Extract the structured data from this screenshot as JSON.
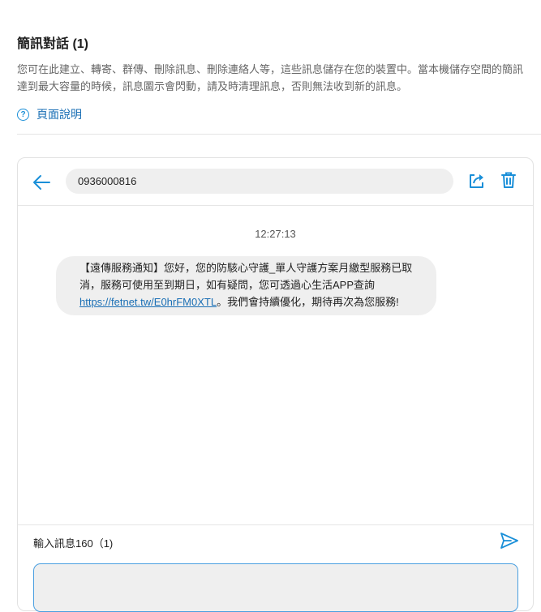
{
  "header": {
    "title": "簡訊對話 (1)",
    "description": "您可在此建立、轉寄、群傳、刪除訊息、刪除連絡人等，這些訊息儲存在您的裝置中。當本機儲存空間的簡訊達到最大容量的時候，訊息圖示會閃動，請及時清理訊息，否則無法收到新的訊息。",
    "help_label": "頁面說明",
    "help_icon": "question-circle-icon"
  },
  "conversation": {
    "phone_number": "0936000816",
    "icons": {
      "back": "arrow-left-icon",
      "share": "share-icon",
      "delete": "trash-icon",
      "send": "send-icon"
    },
    "accent_color": "#1a8fd8"
  },
  "messages": [
    {
      "time": "12:27:13",
      "text_before_link": "【遠傳服務通知】您好，您的防駭心守護_單人守護方案月繳型服務已取消，服務可使用至到期日，如有疑問，您可透過心生活APP查詢 ",
      "link": "https://fetnet.tw/E0hrFM0XTL",
      "text_after_link": "。我們會持續優化，期待再次為您服務!"
    }
  ],
  "composer": {
    "label": "輸入訊息160（1)",
    "value": "",
    "placeholder": ""
  }
}
